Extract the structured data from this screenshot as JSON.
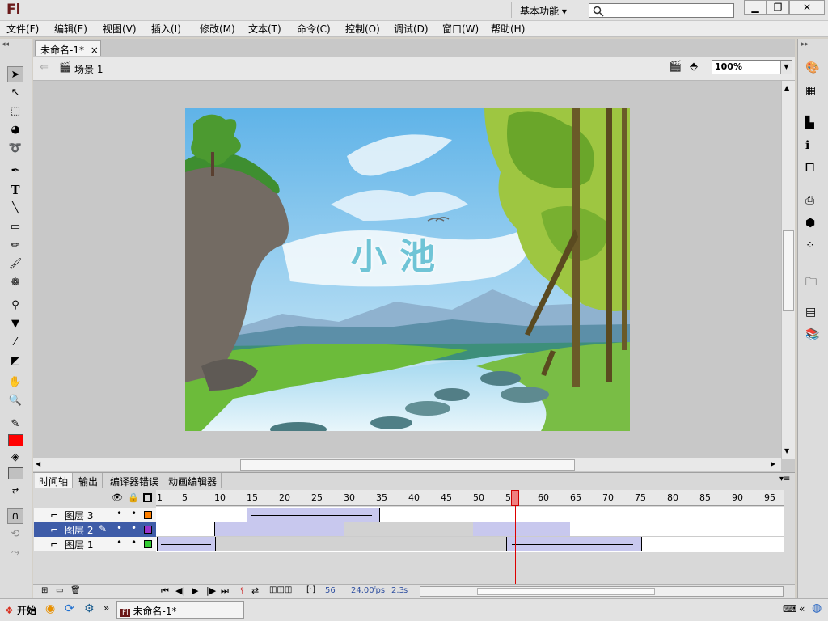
{
  "app": {
    "logo": "Fl",
    "workspace": "基本功能 ▾",
    "win_min": "▁",
    "win_restore": "❐",
    "win_close": "✕"
  },
  "menu": [
    "文件(F)",
    "编辑(E)",
    "视图(V)",
    "插入(I)",
    "修改(M)",
    "文本(T)",
    "命令(C)",
    "控制(O)",
    "调试(D)",
    "窗口(W)",
    "帮助(H)"
  ],
  "document": {
    "tab": "未命名-1*",
    "tab_close": "×",
    "scene": "场景 1",
    "zoom": "100%"
  },
  "stage": {
    "title_text": "小池"
  },
  "panel_tabs": [
    "时间轴",
    "输出",
    "编译器错误",
    "动画编辑器"
  ],
  "timeline": {
    "ruler": [
      "1",
      "5",
      "10",
      "15",
      "20",
      "25",
      "30",
      "35",
      "40",
      "45",
      "50",
      "55",
      "60",
      "65",
      "70",
      "75",
      "80",
      "85",
      "90",
      "95"
    ],
    "layers": [
      {
        "name": "图层 3"
      },
      {
        "name": "图层 2"
      },
      {
        "name": "图层 1"
      }
    ],
    "current_frame": "56",
    "fps": "24.00",
    "fps_unit": "fps",
    "time": "2.3",
    "time_unit": "s"
  },
  "taskbar": {
    "start": "开始",
    "task": "未命名-1*",
    "more": "»",
    "tray_more": "«"
  }
}
